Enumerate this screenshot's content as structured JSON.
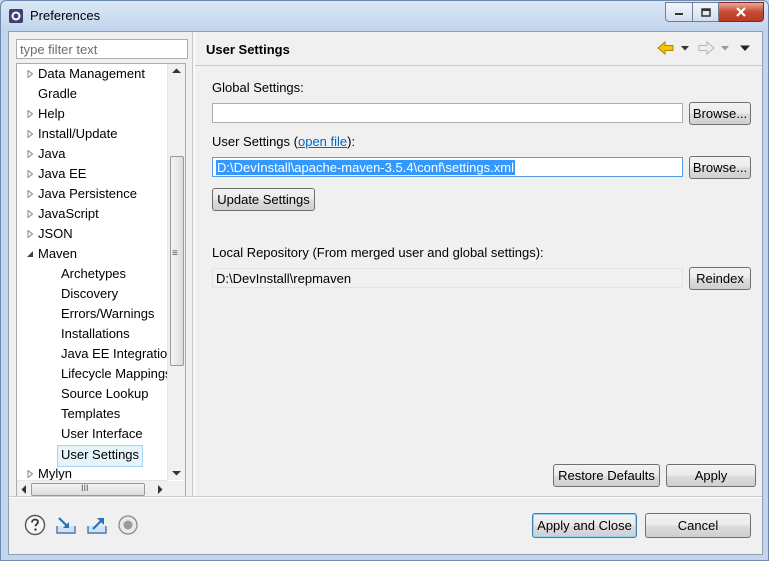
{
  "window": {
    "title": "Preferences"
  },
  "filter": {
    "placeholder": "type filter text"
  },
  "tree": {
    "items": [
      {
        "label": "Data Management",
        "level": 0,
        "expander": "collapsed"
      },
      {
        "label": "Gradle",
        "level": 0,
        "expander": "none"
      },
      {
        "label": "Help",
        "level": 0,
        "expander": "collapsed"
      },
      {
        "label": "Install/Update",
        "level": 0,
        "expander": "collapsed"
      },
      {
        "label": "Java",
        "level": 0,
        "expander": "collapsed"
      },
      {
        "label": "Java EE",
        "level": 0,
        "expander": "collapsed"
      },
      {
        "label": "Java Persistence",
        "level": 0,
        "expander": "collapsed"
      },
      {
        "label": "JavaScript",
        "level": 0,
        "expander": "collapsed"
      },
      {
        "label": "JSON",
        "level": 0,
        "expander": "collapsed"
      },
      {
        "label": "Maven",
        "level": 0,
        "expander": "expanded"
      },
      {
        "label": "Archetypes",
        "level": 1,
        "expander": "none"
      },
      {
        "label": "Discovery",
        "level": 1,
        "expander": "none"
      },
      {
        "label": "Errors/Warnings",
        "level": 1,
        "expander": "none"
      },
      {
        "label": "Installations",
        "level": 1,
        "expander": "none"
      },
      {
        "label": "Java EE Integration",
        "level": 1,
        "expander": "none"
      },
      {
        "label": "Lifecycle Mappings",
        "level": 1,
        "expander": "none"
      },
      {
        "label": "Source Lookup",
        "level": 1,
        "expander": "none"
      },
      {
        "label": "Templates",
        "level": 1,
        "expander": "none"
      },
      {
        "label": "User Interface",
        "level": 1,
        "expander": "none"
      },
      {
        "label": "User Settings",
        "level": 1,
        "expander": "none",
        "selected": true
      },
      {
        "label": "Mylyn",
        "level": 0,
        "expander": "collapsed"
      }
    ],
    "hscroll_grip": "III",
    "vscroll_grip": "≡"
  },
  "page": {
    "title": "User Settings",
    "global_settings_label": "Global Settings:",
    "global_settings_value": "",
    "user_settings_label": "User Settings (",
    "open_file_link": "open file",
    "user_settings_label_end": "):",
    "user_settings_value": "D:\\DevInstall\\apache-maven-3.5.4\\conf\\settings.xml",
    "local_repo_label": "Local Repository (From merged user and global settings):",
    "local_repo_value": "D:\\DevInstall\\repmaven"
  },
  "buttons": {
    "browse": "Browse...",
    "update_settings": "Update Settings",
    "reindex": "Reindex",
    "restore_defaults": "Restore Defaults",
    "apply": "Apply",
    "apply_and_close": "Apply and Close",
    "cancel": "Cancel"
  },
  "colors": {
    "selection": "#3399ff",
    "link": "#0066cc",
    "nav_back": "#f5c400"
  }
}
